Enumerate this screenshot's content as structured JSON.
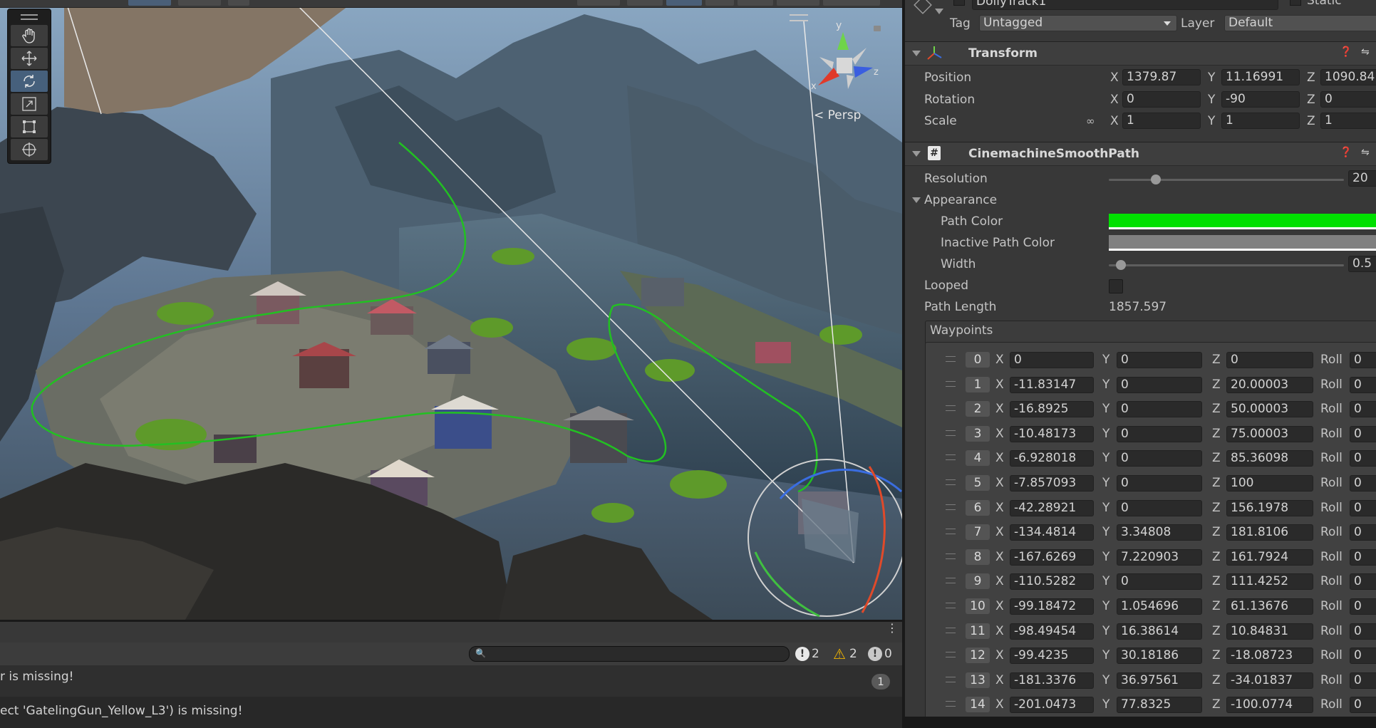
{
  "scene": {
    "persp_label": "< Persp",
    "gizmo": {
      "y": "y",
      "x": "x",
      "z": "z"
    }
  },
  "console": {
    "messages": [
      {
        "text": "r is missing!",
        "count": "1"
      },
      {
        "text": "ect 'GatelingGun_Yellow_L3') is missing!"
      }
    ],
    "counts": {
      "info": "2",
      "warn": "2",
      "error": "0"
    },
    "search_value": ""
  },
  "inspector": {
    "object_name": "DollyTrack1",
    "static_label": "Static",
    "tag_label": "Tag",
    "tag_value": "Untagged",
    "layer_label": "Layer",
    "layer_value": "Default",
    "transform": {
      "title": "Transform",
      "position_label": "Position",
      "rotation_label": "Rotation",
      "scale_label": "Scale",
      "position": {
        "x": "1379.87",
        "y": "11.16991",
        "z": "1090.84"
      },
      "rotation": {
        "x": "0",
        "y": "-90",
        "z": "0"
      },
      "scale": {
        "x": "1",
        "y": "1",
        "z": "1"
      },
      "axis_x": "X",
      "axis_y": "Y",
      "axis_z": "Z"
    },
    "smooth_path": {
      "title": "CinemachineSmoothPath",
      "resolution_label": "Resolution",
      "resolution_value": "20",
      "resolution_fraction": 0.2,
      "appearance_label": "Appearance",
      "path_color_label": "Path Color",
      "path_color": "#00e000",
      "inactive_path_color_label": "Inactive Path Color",
      "inactive_path_color": "#808080",
      "width_label": "Width",
      "width_value": "0.5",
      "width_fraction": 0.05,
      "looped_label": "Looped",
      "path_length_label": "Path Length",
      "path_length_value": "1857.597",
      "waypoints_label": "Waypoints",
      "roll_label": "Roll",
      "waypoints": [
        {
          "i": "0",
          "x": "0",
          "y": "0",
          "z": "0",
          "roll": "0"
        },
        {
          "i": "1",
          "x": "-11.83147",
          "y": "0",
          "z": "20.00003",
          "roll": "0"
        },
        {
          "i": "2",
          "x": "-16.8925",
          "y": "0",
          "z": "50.00003",
          "roll": "0"
        },
        {
          "i": "3",
          "x": "-10.48173",
          "y": "0",
          "z": "75.00003",
          "roll": "0"
        },
        {
          "i": "4",
          "x": "-6.928018",
          "y": "0",
          "z": "85.36098",
          "roll": "0"
        },
        {
          "i": "5",
          "x": "-7.857093",
          "y": "0",
          "z": "100",
          "roll": "0"
        },
        {
          "i": "6",
          "x": "-42.28921",
          "y": "0",
          "z": "156.1978",
          "roll": "0"
        },
        {
          "i": "7",
          "x": "-134.4814",
          "y": "3.34808",
          "z": "181.8106",
          "roll": "0"
        },
        {
          "i": "8",
          "x": "-167.6269",
          "y": "7.220903",
          "z": "161.7924",
          "roll": "0"
        },
        {
          "i": "9",
          "x": "-110.5282",
          "y": "0",
          "z": "111.4252",
          "roll": "0"
        },
        {
          "i": "10",
          "x": "-99.18472",
          "y": "1.054696",
          "z": "61.13676",
          "roll": "0"
        },
        {
          "i": "11",
          "x": "-98.49454",
          "y": "16.38614",
          "z": "10.84831",
          "roll": "0"
        },
        {
          "i": "12",
          "x": "-99.4235",
          "y": "30.18186",
          "z": "-18.08723",
          "roll": "0"
        },
        {
          "i": "13",
          "x": "-181.3376",
          "y": "36.97561",
          "z": "-34.01837",
          "roll": "0"
        },
        {
          "i": "14",
          "x": "-201.0473",
          "y": "77.8325",
          "z": "-100.0774",
          "roll": "0"
        }
      ]
    }
  }
}
